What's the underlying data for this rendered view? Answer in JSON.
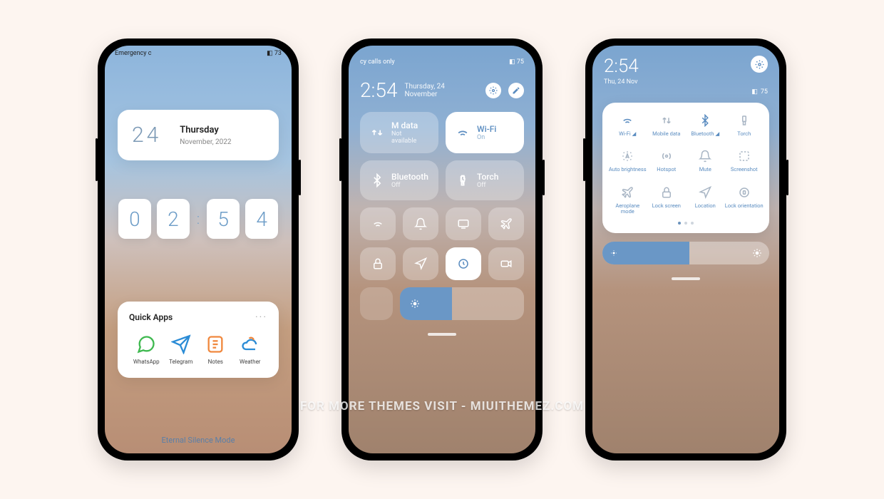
{
  "watermark": "For more themes visit - miuithemez.com",
  "phone1": {
    "status_left": "Emergency c",
    "battery": "73",
    "date_num": "24",
    "date_day": "Thursday",
    "date_sub": "November, 2022",
    "clock": {
      "h1": "0",
      "h2": "2",
      "m1": "5",
      "m2": "4"
    },
    "quick_title": "Quick Apps",
    "quick_apps": [
      {
        "label": "WhatsApp"
      },
      {
        "label": "Telegram"
      },
      {
        "label": "Notes"
      },
      {
        "label": "Weather"
      }
    ],
    "theme_name": "Eternal Silence Mode"
  },
  "phone2": {
    "status_left": "cy calls only",
    "battery": "75",
    "time": "2:54",
    "date": "Thursday, 24 November",
    "tiles": [
      {
        "title": "data",
        "sub": "Not available",
        "prefix": "M"
      },
      {
        "title": "Wi-Fi",
        "sub": "On",
        "on": true
      },
      {
        "title": "Bluetooth",
        "sub": "Off"
      },
      {
        "title": "Torch",
        "sub": "Off"
      }
    ],
    "small": [
      "wifi",
      "bell",
      "cast",
      "airplane",
      "lock",
      "location",
      "rotation-lock",
      "video"
    ],
    "brightness_pct": 42
  },
  "phone3": {
    "time": "2:54",
    "date": "Thu, 24 Nov",
    "battery": "75",
    "toggles": [
      {
        "label": "Wi-Fi ◢",
        "icon": "wifi",
        "active": true
      },
      {
        "label": "Mobile data",
        "icon": "data"
      },
      {
        "label": "Bluetooth ◢",
        "icon": "bluetooth",
        "active": true
      },
      {
        "label": "Torch",
        "icon": "torch"
      },
      {
        "label": "Auto brightness",
        "icon": "auto-bright"
      },
      {
        "label": "Hotspot",
        "icon": "hotspot"
      },
      {
        "label": "Mute",
        "icon": "mute"
      },
      {
        "label": "Screenshot",
        "icon": "screenshot"
      },
      {
        "label": "Aeroplane mode",
        "icon": "airplane"
      },
      {
        "label": "Lock screen",
        "icon": "lock"
      },
      {
        "label": "Location",
        "icon": "location"
      },
      {
        "label": "Lock orientation",
        "icon": "rotation"
      }
    ],
    "brightness_pct": 52
  }
}
